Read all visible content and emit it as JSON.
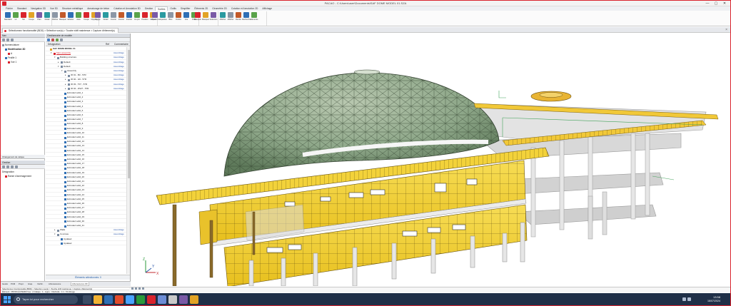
{
  "window": {
    "title": "PACAO - C:\\Users\\user\\Documents\\SAF DOME MODEL 01.SZA",
    "controls": [
      "—",
      "▢",
      "✕"
    ]
  },
  "ribbon": {
    "tabs": [
      "Fichier",
      "Standard",
      "Navigation 3D",
      "Vue 3D",
      "Structure métallique",
      "Armaturage de béton",
      "Cotation et Annotation 3D",
      "Gestion",
      "Sorties",
      "Outils",
      "Simplifier",
      "Éléments 2D",
      "Géométrie 2D",
      "Cotation et Annotation 2D",
      "Affichage"
    ],
    "active_tab": "Sorties",
    "buttons": [
      "Standard",
      "Lit",
      "Mo",
      "Coupe",
      "Plan",
      "Détail",
      "Afficher",
      "Masquer",
      "Éclairer",
      "Auto",
      "Coupe",
      "Clipping",
      "Gruge",
      "Détail",
      "Insérer",
      "Insérer",
      "Insérer",
      "Ins.pro",
      "Position",
      "Calque",
      "Position",
      "Etiquettes",
      "Bloc",
      "Ombre",
      "Vue",
      "Filtre",
      "Masquer",
      "Masquer",
      "Sélection",
      "Afficher",
      "Afficher",
      "Rendu",
      "Recherche",
      "Éléments"
    ]
  },
  "document_tab": {
    "label": "Sélectionnez fonctionnalité (BDD) > Sélection vue(s) > Touche shift maintenue > Capture d'élément(s)"
  },
  "left_panel": {
    "title": "Nav",
    "tree": [
      {
        "label": "Nomenclature",
        "indent": 0
      },
      {
        "label": "Modélisation 3D",
        "indent": 1,
        "bold": true
      },
      {
        "label": "A",
        "indent": 2
      },
      {
        "label": "Feuille 1",
        "indent": 1
      },
      {
        "label": "Vue 1",
        "indent": 2
      }
    ],
    "filter_button": "Changement de calque",
    "second_title": "Gestion",
    "second_header": "Désignation",
    "second_rows": [
      {
        "label": "Rainer d'aménagement",
        "indent": 1
      }
    ]
  },
  "tree_panel": {
    "title": "Gestionnaire de modèle",
    "columns": [
      "Désignation",
      "Ref",
      "Commentaire"
    ],
    "status": "Éléments sélectionnés: 0",
    "rows": [
      {
        "label": "SAF DOME MODEL 01",
        "indent": 0,
        "expand": "",
        "ext": "",
        "style": "root"
      },
      {
        "label": "Main assembly",
        "indent": 1,
        "expand": "▾",
        "ext": "Assemblage",
        "style": "red"
      },
      {
        "label": "Building structure",
        "indent": 2,
        "expand": "▾",
        "ext": "Assemblage",
        "style": "normal"
      },
      {
        "label": "Default",
        "indent": 3,
        "expand": "▸",
        "ext": "Assemblage",
        "style": "normal"
      },
      {
        "label": "Default",
        "indent": 3,
        "expand": "▾",
        "ext": "Assemblage",
        "style": "normal"
      },
      {
        "label": "Assembly",
        "indent": 4,
        "expand": "▾",
        "ext": "Assemblage",
        "style": "normal"
      },
      {
        "label": "IR 01 - B3 - 57R",
        "indent": 5,
        "expand": "▸",
        "ext": "Assemblage",
        "style": "normal"
      },
      {
        "label": "IR 02 - G9 - 57R",
        "indent": 5,
        "expand": "▸",
        "ext": "Assemblage",
        "style": "normal"
      },
      {
        "label": "IR 03 - T07 - 57R",
        "indent": 5,
        "expand": "▸",
        "ext": "Assemblage",
        "style": "normal"
      },
      {
        "label": "IR 04 - ZN27 - 57R",
        "indent": 5,
        "expand": "▸",
        "ext": "Assemblage",
        "style": "normal"
      },
      {
        "label": "Extruded solid_1",
        "indent": 4,
        "expand": "",
        "ext": "",
        "style": "solid"
      },
      {
        "label": "Extruded solid_2",
        "indent": 4,
        "expand": "",
        "ext": "",
        "style": "solid"
      },
      {
        "label": "Extruded solid_3",
        "indent": 4,
        "expand": "",
        "ext": "",
        "style": "solid"
      },
      {
        "label": "Extruded solid_4",
        "indent": 4,
        "expand": "",
        "ext": "",
        "style": "solid"
      },
      {
        "label": "Extruded solid_5",
        "indent": 4,
        "expand": "",
        "ext": "",
        "style": "solid"
      },
      {
        "label": "Extruded solid_6",
        "indent": 4,
        "expand": "",
        "ext": "",
        "style": "solid"
      },
      {
        "label": "Extruded solid_7",
        "indent": 4,
        "expand": "",
        "ext": "",
        "style": "solid"
      },
      {
        "label": "Extruded solid_8",
        "indent": 4,
        "expand": "",
        "ext": "",
        "style": "solid"
      },
      {
        "label": "Extruded solid_9",
        "indent": 4,
        "expand": "",
        "ext": "",
        "style": "solid"
      },
      {
        "label": "Extruded solid_10",
        "indent": 4,
        "expand": "",
        "ext": "",
        "style": "solid"
      },
      {
        "label": "Extruded solid_11",
        "indent": 4,
        "expand": "",
        "ext": "",
        "style": "solid"
      },
      {
        "label": "Extruded solid_12",
        "indent": 4,
        "expand": "",
        "ext": "",
        "style": "solid"
      },
      {
        "label": "Extruded solid_13",
        "indent": 4,
        "expand": "",
        "ext": "",
        "style": "solid"
      },
      {
        "label": "Extruded solid_14",
        "indent": 4,
        "expand": "",
        "ext": "",
        "style": "solid"
      },
      {
        "label": "Extruded solid_15",
        "indent": 4,
        "expand": "",
        "ext": "",
        "style": "solid"
      },
      {
        "label": "Extruded solid_16",
        "indent": 4,
        "expand": "",
        "ext": "",
        "style": "solid"
      },
      {
        "label": "Extruded solid_17",
        "indent": 4,
        "expand": "",
        "ext": "",
        "style": "solid"
      },
      {
        "label": "Extruded solid_18",
        "indent": 4,
        "expand": "",
        "ext": "",
        "style": "solid"
      },
      {
        "label": "Extruded solid_19",
        "indent": 4,
        "expand": "",
        "ext": "",
        "style": "solid"
      },
      {
        "label": "Extruded solid_20",
        "indent": 4,
        "expand": "",
        "ext": "",
        "style": "solid"
      },
      {
        "label": "Extruded solid_21",
        "indent": 4,
        "expand": "",
        "ext": "",
        "style": "solid"
      },
      {
        "label": "Extruded solid_22",
        "indent": 4,
        "expand": "",
        "ext": "",
        "style": "solid"
      },
      {
        "label": "Extruded solid_23",
        "indent": 4,
        "expand": "",
        "ext": "",
        "style": "solid"
      },
      {
        "label": "Extruded solid_24",
        "indent": 4,
        "expand": "",
        "ext": "",
        "style": "solid"
      },
      {
        "label": "Extruded solid_25",
        "indent": 4,
        "expand": "",
        "ext": "",
        "style": "solid"
      },
      {
        "label": "Extruded solid_26",
        "indent": 4,
        "expand": "",
        "ext": "",
        "style": "solid"
      },
      {
        "label": "Extruded solid_27",
        "indent": 4,
        "expand": "",
        "ext": "",
        "style": "solid"
      },
      {
        "label": "Extruded solid_28",
        "indent": 4,
        "expand": "",
        "ext": "",
        "style": "solid"
      },
      {
        "label": "Extruded solid_29",
        "indent": 4,
        "expand": "",
        "ext": "",
        "style": "solid"
      },
      {
        "label": "Extruded solid_30",
        "indent": 4,
        "expand": "",
        "ext": "",
        "style": "solid"
      },
      {
        "label": "Extruded solid_31",
        "indent": 4,
        "expand": "",
        "ext": "",
        "style": "solid"
      },
      {
        "label": "Walls",
        "indent": 2,
        "expand": "▸",
        "ext": "Assemblage",
        "style": "normal"
      },
      {
        "label": "Concrete",
        "indent": 2,
        "expand": "▾",
        "ext": "Assemblage",
        "style": "normal"
      },
      {
        "label": "Updated",
        "indent": 3,
        "expand": "",
        "ext": "",
        "style": "solid"
      },
      {
        "label": "Updated",
        "indent": 3,
        "expand": "",
        "ext": "",
        "style": "solid"
      }
    ]
  },
  "bottom_tabs": [
    "Gestio",
    "PCM",
    "Propr.",
    "Grap.",
    "Vérific.",
    "Arborescence",
    "Arborescence 3D"
  ],
  "bottom_active": "Arborescence 3D",
  "command_line": "Sélectionnez fonctionnalité (BDD) > Sélection vue(s) > Touche shift maintenue > Capture d'élément(s)",
  "status_line": "Élément : PROFILÉ IPE300  Vue : A  Calque : 1 ; Ligne : 0  Echelle : 1:1 ; 5C-Rouge",
  "viewport": {
    "axis_labels": [
      "Z",
      "X",
      "Y"
    ],
    "colors": {
      "dome": "#8fa88a",
      "facade": "#f1d13a",
      "concrete": "#dcdcdc",
      "timber": "#8a6a2a"
    }
  },
  "taskbar": {
    "search_placeholder": "Taper ici pour rechercher",
    "time": "13:58",
    "date": "16/07/2024"
  },
  "colors": {
    "accent": "#d9232d",
    "taskbar": "#1f2f47",
    "link": "#2b56a8"
  }
}
